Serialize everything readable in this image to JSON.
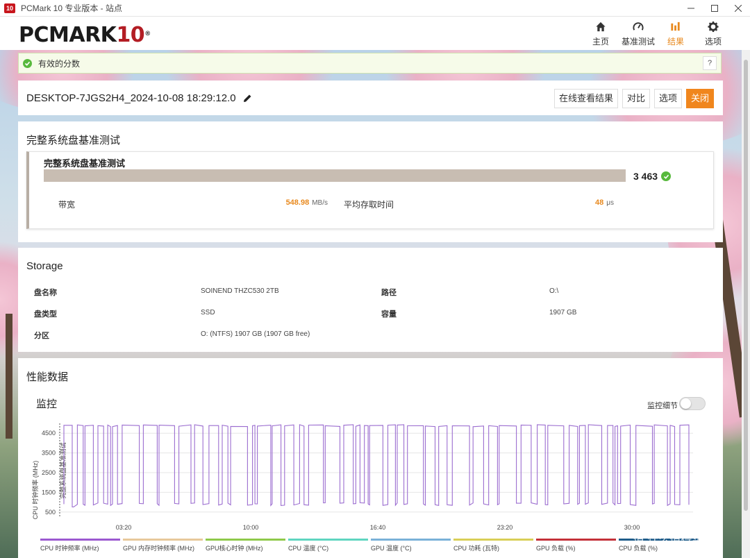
{
  "window": {
    "title": "PCMark 10 专业版本 - 站点",
    "app_icon": "10",
    "controls": [
      "minimize-icon",
      "maximize-icon",
      "close-icon"
    ]
  },
  "header": {
    "logo_text": "PCMARK",
    "logo_number": "10",
    "logo_reg": "®",
    "nav": [
      {
        "label": "主页",
        "icon": "home-icon",
        "active": false
      },
      {
        "label": "基准测试",
        "icon": "gauge-icon",
        "active": false
      },
      {
        "label": "结果",
        "icon": "bar-chart-icon",
        "active": true
      },
      {
        "label": "选项",
        "icon": "gear-icon",
        "active": false
      }
    ],
    "active_color": "#e8891e"
  },
  "status": {
    "text": "有效的分数",
    "help": "?"
  },
  "result": {
    "name": "DESKTOP-7JGS2H4_2024-10-08 18:29:12.0",
    "buttons": {
      "view_online": "在线查看结果",
      "compare": "对比",
      "options": "选项",
      "close": "关闭"
    }
  },
  "benchmark": {
    "section_title": "完整系统盘基准测试",
    "card_title": "完整系统盘基准测试",
    "score": "3 463",
    "bandwidth_label": "带宽",
    "bandwidth_value": "548.98",
    "bandwidth_unit": "MB/s",
    "access_label": "平均存取时间",
    "access_value": "48",
    "access_unit": "μs"
  },
  "storage": {
    "title": "Storage",
    "rows": [
      {
        "label": "盘名称",
        "value": "SOINEND THZC530 2TB",
        "label2": "路径",
        "value2": "O:\\"
      },
      {
        "label": "盘类型",
        "value": "SSD",
        "label2": "容量",
        "value2": "1907 GB"
      },
      {
        "label": "分区",
        "value": "O: (NTFS) 1907 GB (1907 GB free)",
        "label2": "",
        "value2": ""
      }
    ]
  },
  "performance": {
    "title": "性能数据",
    "monitor_title": "监控",
    "toggle_label": "监控细节",
    "toggle_on": false
  },
  "chart_data": {
    "type": "line",
    "ylabel": "CPU 时钟频率 (MHz)",
    "series_annotation": "完整系统盘基准测试",
    "yticks": [
      "4500",
      "3500",
      "2500",
      "1500",
      "500"
    ],
    "ylim": [
      0,
      5000
    ],
    "xticks": [
      "03:20",
      "10:00",
      "16:40",
      "23:20",
      "30:00"
    ],
    "high_value": 4900,
    "low_value": 900,
    "series_color": "#9b6dd0",
    "legend": [
      {
        "name": "CPU 时钟频率 (MHz)",
        "color": "#9b59d0"
      },
      {
        "name": "GPU 内存时钟频率 (MHz)",
        "color": "#e7c89a"
      },
      {
        "name": "GPU核心时钟 (MHz)",
        "color": "#8fc94a"
      },
      {
        "name": "CPU 温度 (°C)",
        "color": "#5fd5c0"
      },
      {
        "name": "GPU 温度 (°C)",
        "color": "#7ab1d8"
      },
      {
        "name": "CPU 功耗 (瓦特)",
        "color": "#d9cf57"
      },
      {
        "name": "GPU 负载 (%)",
        "color": "#c43039"
      },
      {
        "name": "CPU 负载 (%)",
        "color": "#1f5c8a"
      }
    ]
  },
  "watermark": "值 什么值得买"
}
